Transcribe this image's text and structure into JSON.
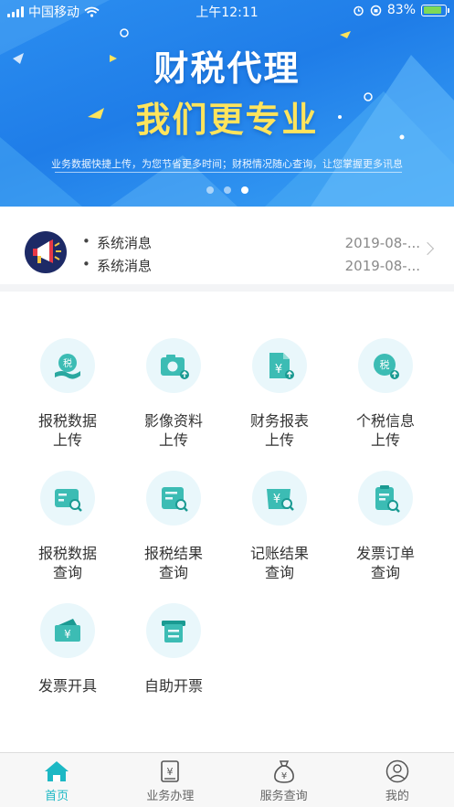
{
  "status_bar": {
    "carrier": "中国移动",
    "time": "上午12:11",
    "battery": "83%"
  },
  "banner": {
    "title_line1": "财税代理",
    "title_line2": "我们更专业",
    "subtitle": "业务数据快捷上传，为您节省更多时间；财税情况随心查询，让您掌握更多讯息",
    "page_count": 3,
    "active_page": 3
  },
  "notices": [
    {
      "title": "系统消息",
      "date": "2019-08-..."
    },
    {
      "title": "系统消息",
      "date": "2019-08-..."
    }
  ],
  "services": [
    {
      "line1": "报税数据",
      "line2": "上传",
      "icon": "tax-upload-icon"
    },
    {
      "line1": "影像资料",
      "line2": "上传",
      "icon": "camera-upload-icon"
    },
    {
      "line1": "财务报表",
      "line2": "上传",
      "icon": "report-upload-icon"
    },
    {
      "line1": "个税信息",
      "line2": "上传",
      "icon": "personal-tax-upload-icon"
    },
    {
      "line1": "报税数据",
      "line2": "查询",
      "icon": "tax-data-search-icon"
    },
    {
      "line1": "报税结果",
      "line2": "查询",
      "icon": "tax-result-search-icon"
    },
    {
      "line1": "记账结果",
      "line2": "查询",
      "icon": "bookkeeping-search-icon"
    },
    {
      "line1": "发票订单",
      "line2": "查询",
      "icon": "invoice-order-search-icon"
    },
    {
      "line1": "发票开具",
      "line2": "",
      "icon": "invoice-issue-icon"
    },
    {
      "line1": "自助开票",
      "line2": "",
      "icon": "self-invoice-icon"
    }
  ],
  "tabs": [
    {
      "label": "首页",
      "icon": "home-icon",
      "active": true
    },
    {
      "label": "业务办理",
      "icon": "business-icon",
      "active": false
    },
    {
      "label": "服务查询",
      "icon": "money-bag-icon",
      "active": false
    },
    {
      "label": "我的",
      "icon": "profile-icon",
      "active": false
    }
  ],
  "colors": {
    "accent": "#1cb8c4",
    "banner": "#1f7de8",
    "highlight": "#ffe45c"
  }
}
